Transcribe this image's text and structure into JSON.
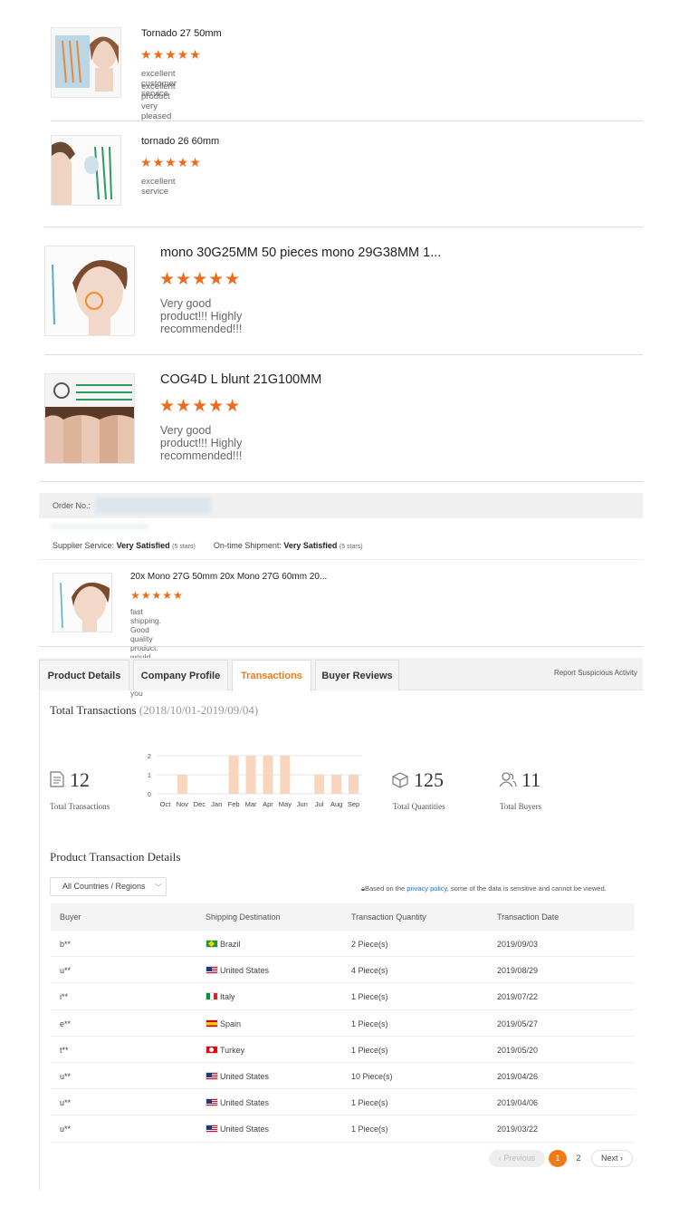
{
  "reviews": [
    {
      "title": "Tornado 27 50mm",
      "stars": "★★★★★",
      "lines": [
        "excellent customer service",
        "excellent product very pleased"
      ]
    },
    {
      "title": "tornado 26 60mm",
      "stars": "★★★★★",
      "lines": [
        "excellent service"
      ]
    },
    {
      "title": "mono 30G25MM 50 pieces mono 29G38MM 1...",
      "stars": "★★★★★",
      "lines": [
        "Very good product!!! Highly recommended!!!"
      ]
    },
    {
      "title": "COG4D L blunt 21G100MM",
      "stars": "★★★★★",
      "lines": [
        "Very good product!!! Highly recommended!!!"
      ]
    }
  ],
  "order": {
    "order_label": "Order No.:",
    "supplier_service_label": "Supplier Service:",
    "supplier_service_value": "Very Satisfied",
    "supplier_service_stars": "(5 stars)",
    "shipment_label": "On-time Shipment:",
    "shipment_value": "Very Satisfied",
    "shipment_stars": "(5 stars)",
    "review": {
      "title": "20x Mono 27G 50mm 20x Mono 27G 60mm 20...",
      "stars": "★★★★★",
      "text": "fast shipping. Good quality product. would buy again. thank you"
    }
  },
  "tabs": [
    "Product Details",
    "Company Profile",
    "Transactions",
    "Buyer Reviews"
  ],
  "active_tab": "Transactions",
  "report_link": "Report Suspicious Activity",
  "total": {
    "title": "Total Transactions",
    "range": "(2018/10/01-2019/09/04)",
    "transactions": "12",
    "transactions_label": "Total Transactions",
    "quantities": "125",
    "quantities_label": "Total Quantities",
    "buyers": "11",
    "buyers_label": "Total Buyers"
  },
  "chart_data": {
    "type": "bar",
    "categories": [
      "Oct",
      "Nov",
      "Dec",
      "Jan",
      "Feb",
      "Mar",
      "Apr",
      "May",
      "Jun",
      "Jul",
      "Aug",
      "Sep"
    ],
    "values": [
      0,
      1,
      0,
      0,
      2,
      2,
      2,
      2,
      0,
      1,
      1,
      1
    ],
    "y_ticks": [
      "0",
      "1",
      "2"
    ],
    "ylim": [
      0,
      2
    ],
    "bar_color": "#f9d5bd",
    "grid": true
  },
  "details": {
    "title": "Product Transaction Details",
    "region_select": "All Countries / Regions",
    "policy_prefix": "Based on the ",
    "policy_link": "privacy policy",
    "policy_suffix": ", some of the data is sensitive and cannot be viewed.",
    "columns": [
      "Buyer",
      "Shipping Destination",
      "Transaction Quantity",
      "Transaction Date"
    ],
    "rows": [
      {
        "buyer": "b**",
        "flag": "br",
        "dest": "Brazil",
        "qty": "2 Piece(s)",
        "date": "2019/09/03"
      },
      {
        "buyer": "u**",
        "flag": "us",
        "dest": "United States",
        "qty": "4 Piece(s)",
        "date": "2019/08/29"
      },
      {
        "buyer": "i**",
        "flag": "it",
        "dest": "Italy",
        "qty": "1 Piece(s)",
        "date": "2019/07/22"
      },
      {
        "buyer": "e**",
        "flag": "es",
        "dest": "Spain",
        "qty": "1 Piece(s)",
        "date": "2019/05/27"
      },
      {
        "buyer": "t**",
        "flag": "tr",
        "dest": "Turkey",
        "qty": "1 Piece(s)",
        "date": "2019/05/20"
      },
      {
        "buyer": "u**",
        "flag": "us",
        "dest": "United States",
        "qty": "10 Piece(s)",
        "date": "2019/04/26"
      },
      {
        "buyer": "u**",
        "flag": "us",
        "dest": "United States",
        "qty": "1 Piece(s)",
        "date": "2019/04/06"
      },
      {
        "buyer": "u**",
        "flag": "us",
        "dest": "United States",
        "qty": "1 Piece(s)",
        "date": "2019/03/22"
      }
    ]
  },
  "pagination": {
    "prev": "Previous",
    "pages": [
      "1",
      "2"
    ],
    "current": "1",
    "next": "Next"
  },
  "colors": {
    "accent": "#f07a16",
    "star": "#f06a1a",
    "link": "#2a70c0"
  }
}
